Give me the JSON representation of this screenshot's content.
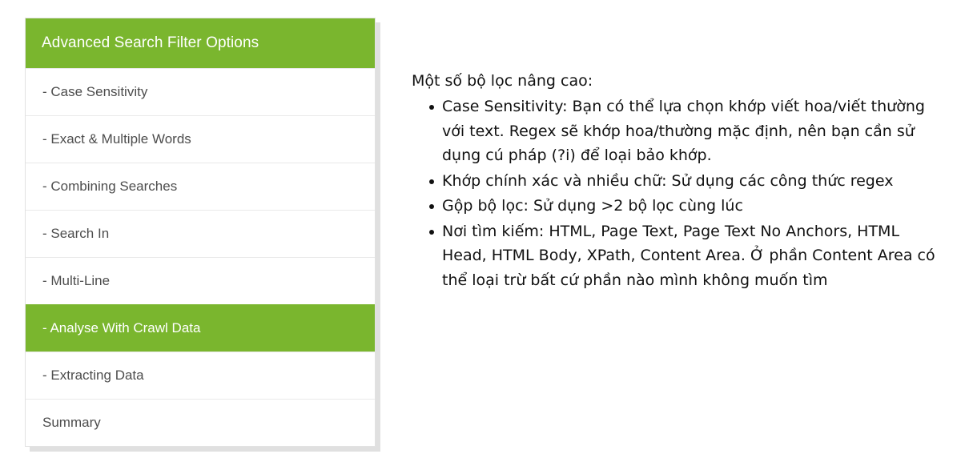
{
  "sidebar": {
    "header": "Advanced Search Filter Options",
    "items": [
      {
        "label": "- Case Sensitivity",
        "active": false
      },
      {
        "label": "- Exact & Multiple Words",
        "active": false
      },
      {
        "label": "- Combining Searches",
        "active": false
      },
      {
        "label": "- Search In",
        "active": false
      },
      {
        "label": "- Multi-Line",
        "active": false
      },
      {
        "label": "- Analyse With Crawl Data",
        "active": true
      },
      {
        "label": "- Extracting Data",
        "active": false
      },
      {
        "label": "Summary",
        "active": false
      }
    ]
  },
  "content": {
    "intro": "Một số bộ lọc nâng cao:",
    "bullets": [
      "Case Sensitivity: Bạn có thể lựa chọn khớp viết hoa/viết thường với text. Regex sẽ khớp hoa/thường mặc định, nên bạn cần sử dụng cú pháp (?i) để loại bảo khớp.",
      "Khớp chính xác và nhiều chữ: Sử dụng các công thức regex",
      "Gộp bộ lọc: Sử dụng >2 bộ lọc cùng lúc",
      "Nơi tìm kiếm: HTML, Page Text, Page Text No Anchors, HTML Head, HTML Body, XPath, Content Area. Ở phần Content Area có thể loại trừ bất cứ phần nào mình không muốn tìm"
    ]
  },
  "colors": {
    "accent_green": "#7ab62e",
    "text_dark": "#4d4d4d",
    "text_body": "#111111",
    "separator": "#e9e9e9",
    "shadow": "#e0e0e0",
    "page_background": "#ffffff"
  }
}
